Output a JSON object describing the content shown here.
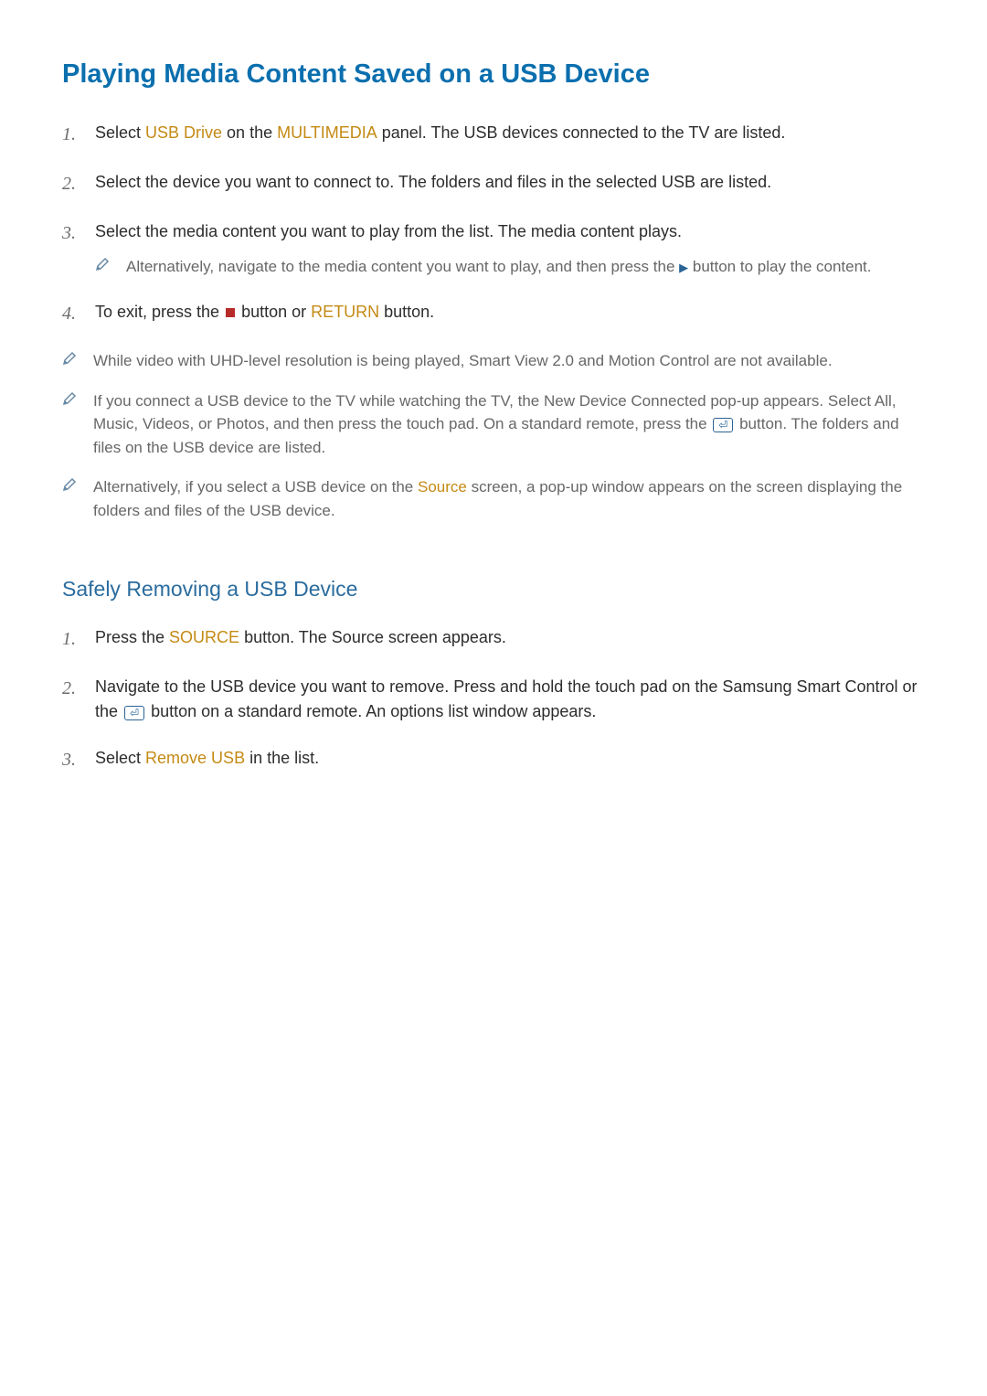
{
  "headings": {
    "h1": "Playing Media Content Saved on a USB Device",
    "h2": "Safely Removing a USB Device"
  },
  "list1": {
    "items": [
      {
        "num": "1.",
        "text_before_hl1": "Select ",
        "hl1": "USB Drive",
        "text_after_hl1": " on the ",
        "hl2": "MULTIMEDIA",
        "text_after_hl2": " panel. The USB devices connected to the TV are listed."
      },
      {
        "num": "2.",
        "text": "Select the device you want to connect to. The folders and files in the selected USB are listed."
      },
      {
        "num": "3.",
        "text": "Select the media content you want to play from the list. The media content plays.",
        "subnote_before": "Alternatively, navigate to the media content you want to play, and then press the ",
        "subnote_after": " button to play the content."
      },
      {
        "num": "4.",
        "text_before": "To exit, press the ",
        "text_mid": " button or ",
        "hl": "RETURN",
        "text_after": " button."
      }
    ]
  },
  "notes": [
    "While video with UHD-level resolution is being played, Smart View 2.0 and Motion Control are not available.",
    {
      "before": "If you connect a USB device to the TV while watching the TV, the New Device Connected pop-up appears. Select All, Music, Videos, or Photos, and then press the touch pad. On a standard remote, press the ",
      "after": " button. The folders and files on the USB device are listed."
    },
    {
      "before": "Alternatively, if you select a USB device on the ",
      "hl": "Source",
      "after": " screen, a pop-up window appears on the screen displaying the folders and files of the USB device."
    }
  ],
  "list2": {
    "items": [
      {
        "num": "1.",
        "text_before": "Press the ",
        "hl": "SOURCE",
        "text_after": " button. The Source screen appears."
      },
      {
        "num": "2.",
        "text_before": "Navigate to the USB device you want to remove. Press and hold the touch pad on the Samsung Smart Control or the ",
        "text_after": " button on a standard remote. An options list window appears."
      },
      {
        "num": "3.",
        "text_before": "Select ",
        "hl": "Remove USB",
        "text_after": " in the list."
      }
    ]
  },
  "glyphs": {
    "play": "▶",
    "enter": "⏎"
  }
}
